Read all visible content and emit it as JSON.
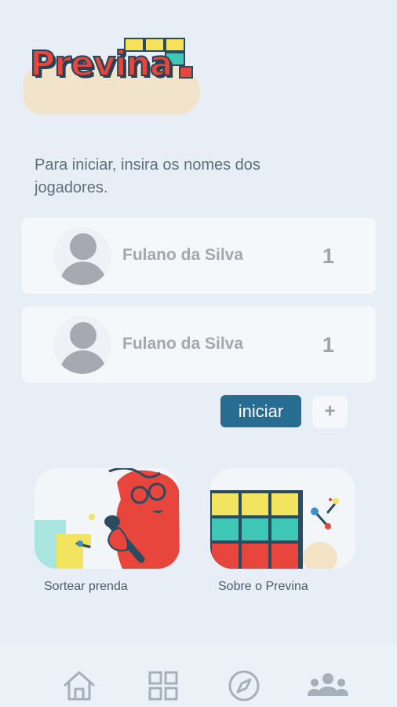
{
  "app": {
    "logo_text": "Previna"
  },
  "intro": {
    "text": "Para iniciar, insira os nomes dos jogadores."
  },
  "players": [
    {
      "name": "Fulano da Silva",
      "number": "1"
    },
    {
      "name": "Fulano da Silva",
      "number": "1"
    }
  ],
  "actions": {
    "start_label": "iniciar",
    "add_label": "+"
  },
  "features": [
    {
      "label": "Sortear prenda",
      "icon": "karaoke-illustration"
    },
    {
      "label": "Sobre o Previna",
      "icon": "blocks-illustration"
    }
  ],
  "nav": [
    {
      "icon": "home-icon"
    },
    {
      "icon": "grid-icon"
    },
    {
      "icon": "compass-icon"
    },
    {
      "icon": "group-icon"
    }
  ],
  "colors": {
    "accent": "#276c91",
    "background": "#e7eef5",
    "card": "#f4f8fb",
    "logo_red": "#e8453c"
  }
}
